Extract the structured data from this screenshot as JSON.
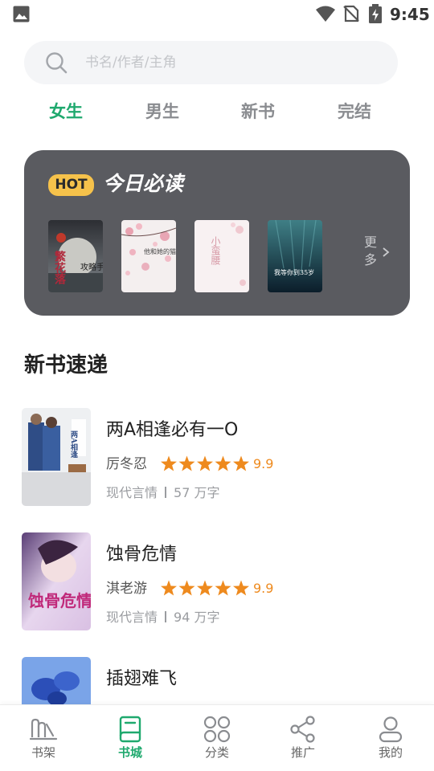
{
  "status_bar": {
    "time": "9:45"
  },
  "search": {
    "placeholder": "书名/作者/主角"
  },
  "tabs": [
    {
      "label": "女生",
      "active": true
    },
    {
      "label": "男生",
      "active": false
    },
    {
      "label": "新书",
      "active": false
    },
    {
      "label": "完结",
      "active": false
    }
  ],
  "hot": {
    "badge": "HOT",
    "title": "今日必读",
    "more_label": "更多",
    "covers": [
      {
        "title": "繁花落",
        "subtitle": "攻略手册"
      },
      {
        "title": "他和她的猫",
        "subtitle": ""
      },
      {
        "title": "小蛮腰",
        "subtitle": ""
      },
      {
        "title": "我等你到35岁",
        "subtitle": ""
      }
    ]
  },
  "section_title": "新书速递",
  "books": [
    {
      "title": "两A相逢必有一O",
      "author": "厉冬忍",
      "score": "9.9",
      "rating": 5,
      "genre": "现代言情",
      "words": "57 万字",
      "cover_text": "两A相逢"
    },
    {
      "title": "蚀骨危情",
      "author": "淇老游",
      "score": "9.9",
      "rating": 5,
      "genre": "现代言情",
      "words": "94 万字",
      "cover_text": "蚀骨危情"
    },
    {
      "title": "插翅难飞",
      "author": "",
      "score": "",
      "rating": 0,
      "genre": "",
      "words": "",
      "cover_text": ""
    }
  ],
  "nav": [
    {
      "label": "书架",
      "icon": "bookshelf-icon",
      "active": false
    },
    {
      "label": "书城",
      "icon": "book-icon",
      "active": true
    },
    {
      "label": "分类",
      "icon": "category-icon",
      "active": false
    },
    {
      "label": "推广",
      "icon": "share-icon",
      "active": false
    },
    {
      "label": "我的",
      "icon": "profile-icon",
      "active": false
    }
  ],
  "colors": {
    "accent": "#1fa96e",
    "hot_card": "#5a5b60",
    "badge": "#f6c24b",
    "star": "#ee8a1e"
  }
}
